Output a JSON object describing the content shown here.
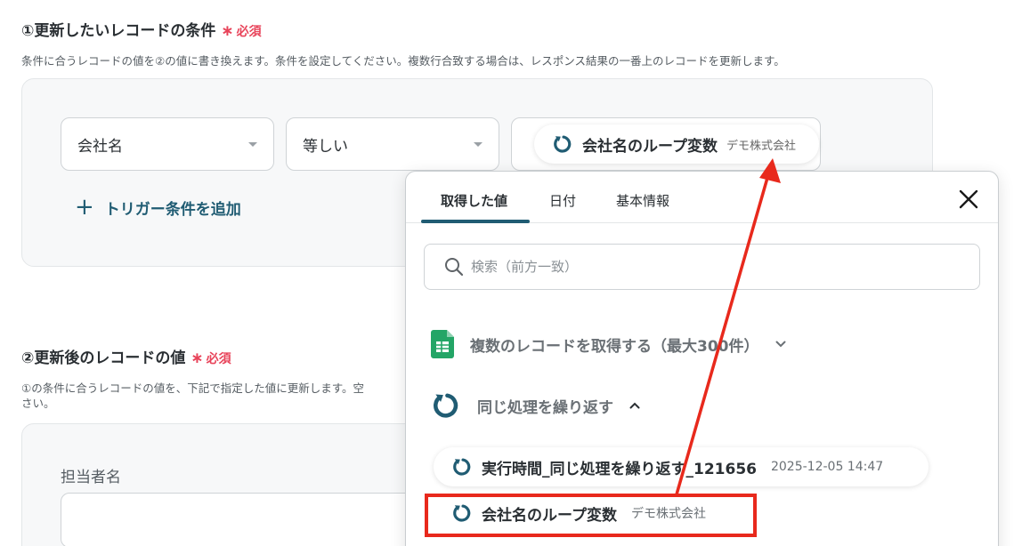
{
  "section1": {
    "title": "①更新したいレコードの条件",
    "required_star": "∗",
    "required_label": "必須",
    "description": "条件に合うレコードの値を②の値に書き換えます。条件を設定してください。複数行合致する場合は、レスポンス結果の一番上のレコードを更新します。",
    "field_select": "会社名",
    "operator_select": "等しい",
    "value_chip": {
      "label": "会社名のループ変数",
      "value": "デモ株式会社"
    },
    "add_trigger_label": "トリガー条件を追加"
  },
  "section2": {
    "title": "②更新後のレコードの値",
    "required_star": "∗",
    "required_label": "必須",
    "description_line1": "①の条件に合うレコードの値を、下記で指定した値に更新します。空",
    "description_line2": "さい。",
    "field_label": "担当者名"
  },
  "popup": {
    "tabs": [
      "取得した値",
      "日付",
      "基本情報"
    ],
    "search_placeholder": "検索（前方一致）",
    "groups": [
      {
        "label": "複数のレコードを取得する（最大300件）",
        "icon": "sheets-icon",
        "expanded": false
      },
      {
        "label": "同じ処理を繰り返す",
        "icon": "loop-icon",
        "expanded": true
      }
    ],
    "items": [
      {
        "label": "実行時間_同じ処理を繰り返す_121656",
        "value": "2025-12-05 14:47"
      },
      {
        "label": "会社名のループ変数",
        "value": "デモ株式会社"
      }
    ]
  },
  "colors": {
    "accent": "#205c73",
    "required": "#e8445a",
    "highlight": "#e8291c"
  }
}
